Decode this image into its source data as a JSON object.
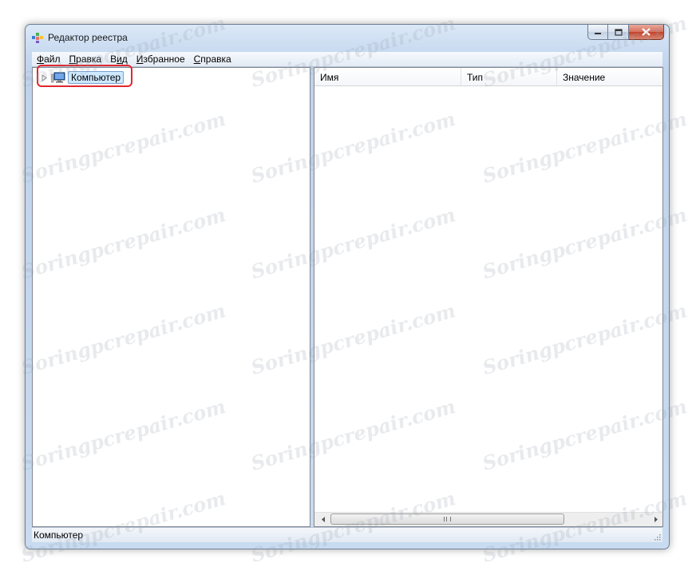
{
  "window": {
    "title": "Редактор реестра"
  },
  "menu": {
    "items": [
      {
        "accel": "Ф",
        "rest": "айл"
      },
      {
        "accel": "П",
        "rest": "равка"
      },
      {
        "pre": "В",
        "accel": "и",
        "rest": "д"
      },
      {
        "accel": "И",
        "rest": "збранное"
      },
      {
        "accel": "С",
        "rest": "правка"
      }
    ]
  },
  "tree": {
    "root_label": "Компьютер"
  },
  "list": {
    "columns": [
      "Имя",
      "Тип",
      "Значение"
    ]
  },
  "statusbar": {
    "text": "Компьютер"
  },
  "watermark": {
    "text": "Soringpcrepair.com"
  },
  "colors": {
    "highlight": "#e0282e",
    "selection": "#cde8ff",
    "close_button": "#c4412a"
  },
  "icons": [
    "registry-editor-icon",
    "minimize-icon",
    "maximize-icon",
    "close-icon",
    "expand-triangle-icon",
    "computer-icon",
    "scroll-left-icon",
    "scroll-right-icon",
    "size-grip-icon"
  ]
}
